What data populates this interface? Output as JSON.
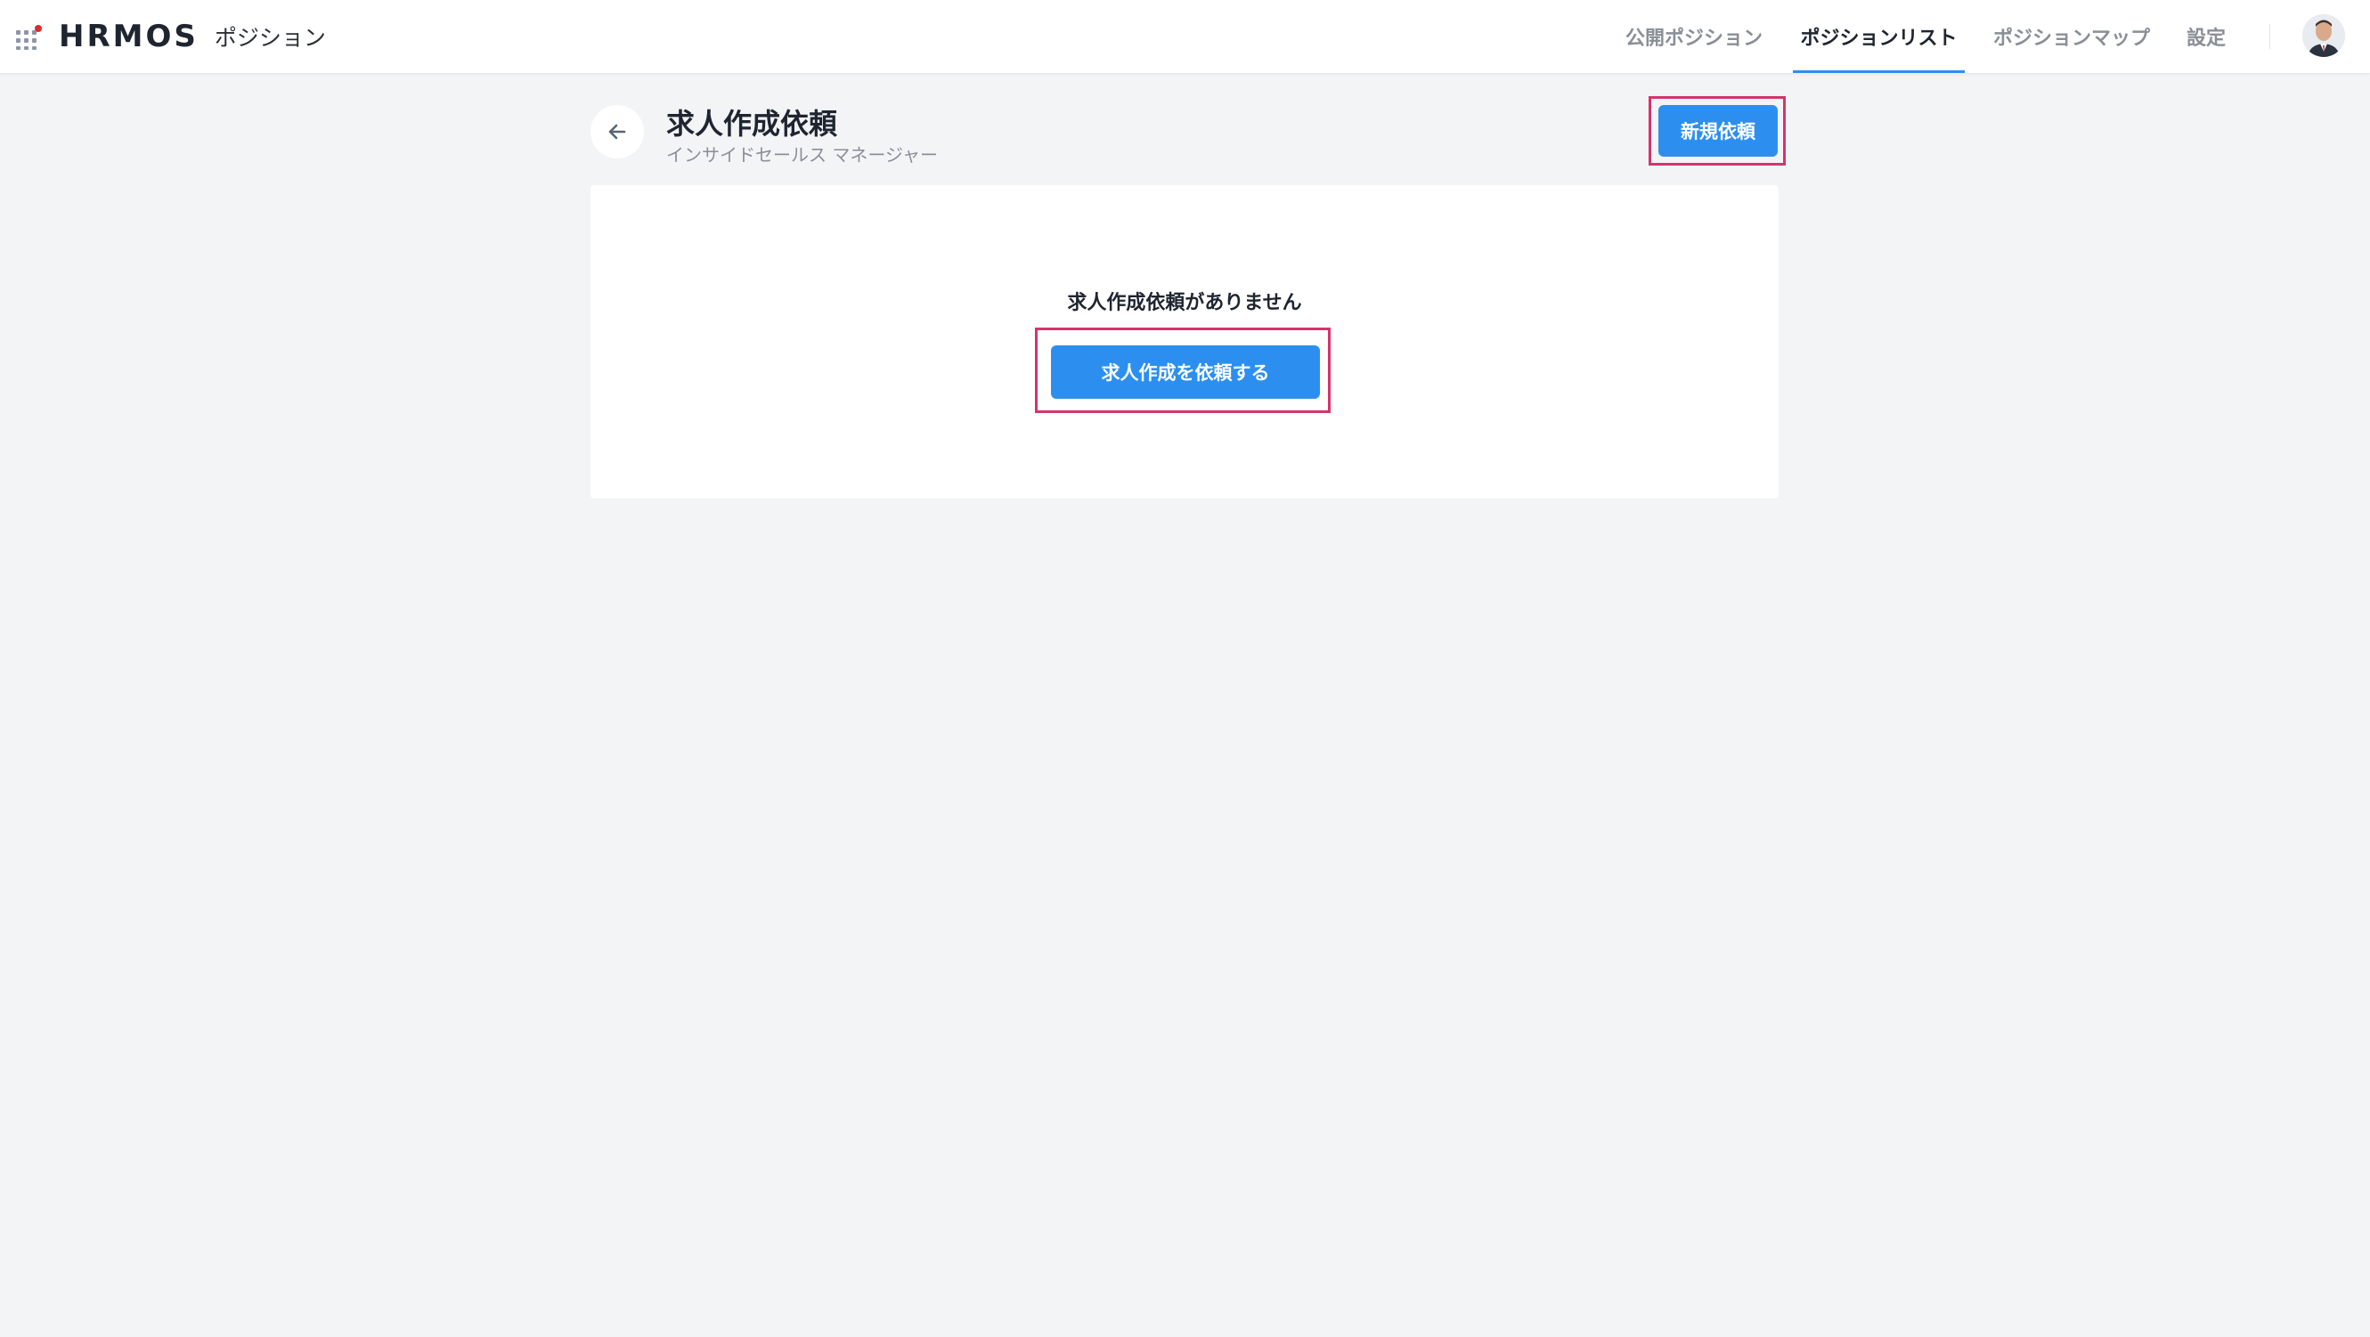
{
  "header": {
    "app_menu_icon": "grid-dots-icon",
    "brand_logo": "HRMOS",
    "brand_product": "ポジション",
    "nav": [
      {
        "label": "公開ポジション",
        "active": false
      },
      {
        "label": "ポジションリスト",
        "active": true
      },
      {
        "label": "ポジションマップ",
        "active": false
      },
      {
        "label": "設定",
        "active": false
      }
    ],
    "avatar_icon": "user-avatar"
  },
  "page": {
    "back_icon": "arrow-left-icon",
    "title": "求人作成依頼",
    "subtitle": "インサイドセールス マネージャー",
    "new_request_label": "新規依頼"
  },
  "empty_state": {
    "message": "求人作成依頼がありません",
    "create_label": "求人作成を依頼する"
  },
  "colors": {
    "accent": "#2c8ff0",
    "highlight": "#d6336c",
    "brand_dot": "#e0282d",
    "background": "#f3f4f6"
  }
}
